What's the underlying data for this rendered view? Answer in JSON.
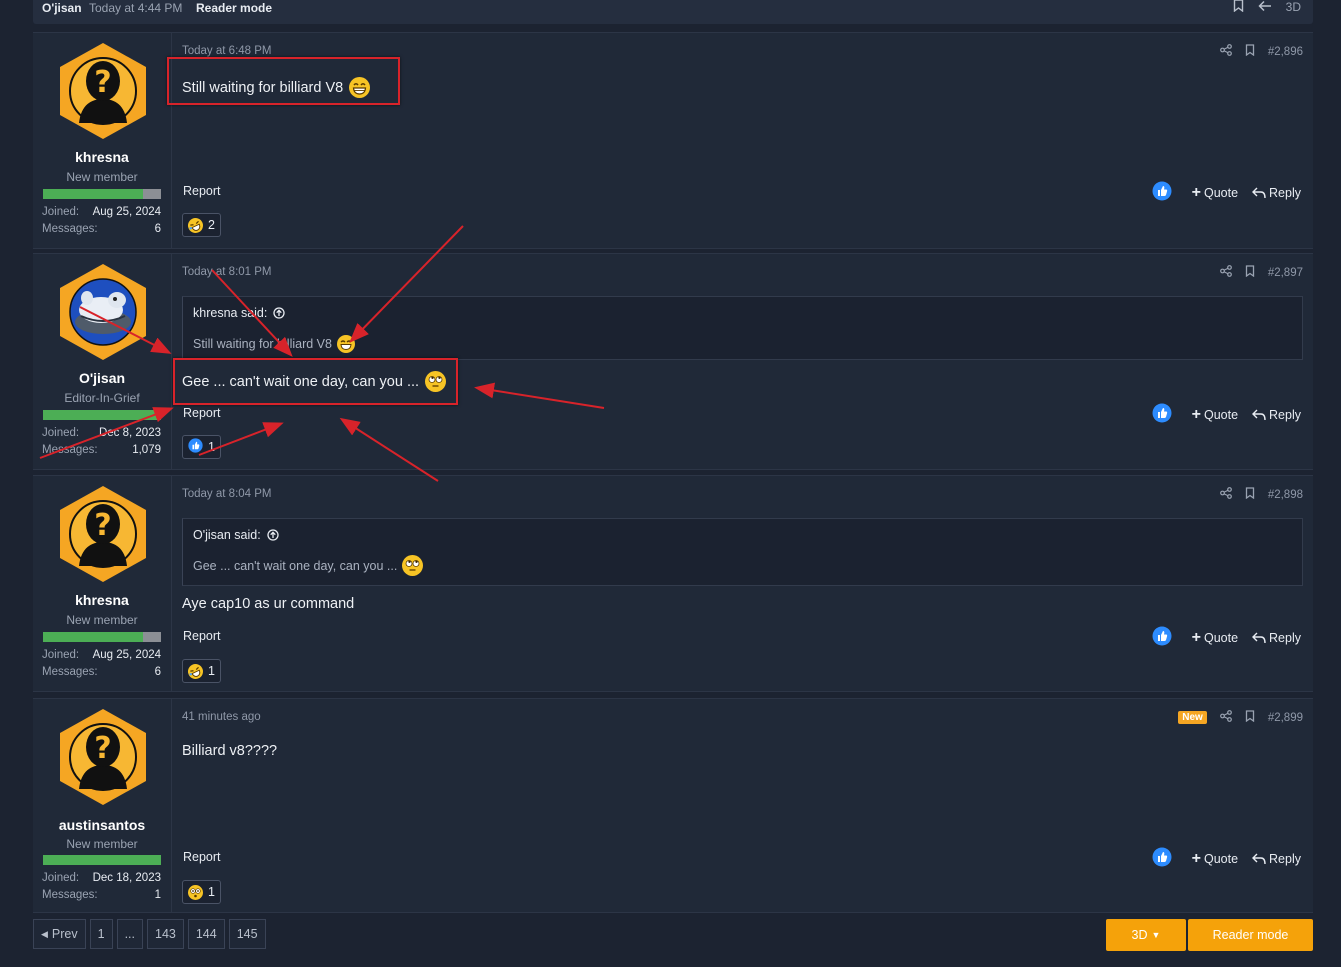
{
  "topbar": {
    "user": "O'jisan",
    "time": "Today at 4:44 PM",
    "reader_mode": "Reader mode",
    "threed": "3D"
  },
  "posts": [
    {
      "user": {
        "name": "khresna",
        "title": "New member",
        "joined_label": "Joined:",
        "joined": "Aug 25, 2024",
        "messages_label": "Messages:",
        "messages": "6",
        "progress": 0.85,
        "avatar": "unknown-user"
      },
      "time": "Today at 6:48 PM",
      "number": "#2,896",
      "new": "",
      "body": "Still waiting for billiard V8",
      "report": "Report",
      "reaction_count": "2",
      "reaction_icon": "rofl-emoji"
    },
    {
      "user": {
        "name": "O'jisan",
        "title": "Editor-In-Grief",
        "joined_label": "Joined:",
        "joined": "Dec 8, 2023",
        "messages_label": "Messages:",
        "messages": "1,079",
        "progress": 1.0,
        "avatar": "cartoon-avatar"
      },
      "time": "Today at 8:01 PM",
      "number": "#2,897",
      "new": "",
      "quote_author": "khresna said:",
      "quote_text": "Still waiting for billiard V8",
      "body": "Gee ... can't wait one day, can you ...",
      "report": "Report",
      "reaction_count": "1",
      "reaction_icon": "like-icon"
    },
    {
      "user": {
        "name": "khresna",
        "title": "New member",
        "joined_label": "Joined:",
        "joined": "Aug 25, 2024",
        "messages_label": "Messages:",
        "messages": "6",
        "progress": 0.85,
        "avatar": "unknown-user"
      },
      "time": "Today at 8:04 PM",
      "number": "#2,898",
      "new": "",
      "quote_author": "O'jisan said:",
      "quote_text": "Gee ... can't wait one day, can you ...",
      "body": "Aye cap10 as ur command",
      "report": "Report",
      "reaction_count": "1",
      "reaction_icon": "rofl-emoji"
    },
    {
      "user": {
        "name": "austinsantos",
        "title": "New member",
        "joined_label": "Joined:",
        "joined": "Dec 18, 2023",
        "messages_label": "Messages:",
        "messages": "1",
        "progress": 1.0,
        "avatar": "unknown-user"
      },
      "time": "41 minutes ago",
      "number": "#2,899",
      "new": "New",
      "body": "Billiard v8????",
      "report": "Report",
      "reaction_count": "1",
      "reaction_icon": "flushed-emoji"
    }
  ],
  "actions": {
    "quote": "Quote",
    "reply": "Reply"
  },
  "pager": {
    "prev": "Prev",
    "pages": [
      "1",
      "...",
      "143",
      "144",
      "145"
    ]
  },
  "bottom": {
    "threed": "3D",
    "reader_mode": "Reader mode"
  },
  "colors": {
    "accent": "#f5a20a",
    "like": "#2d8cff",
    "annotation": "#d8232a"
  }
}
